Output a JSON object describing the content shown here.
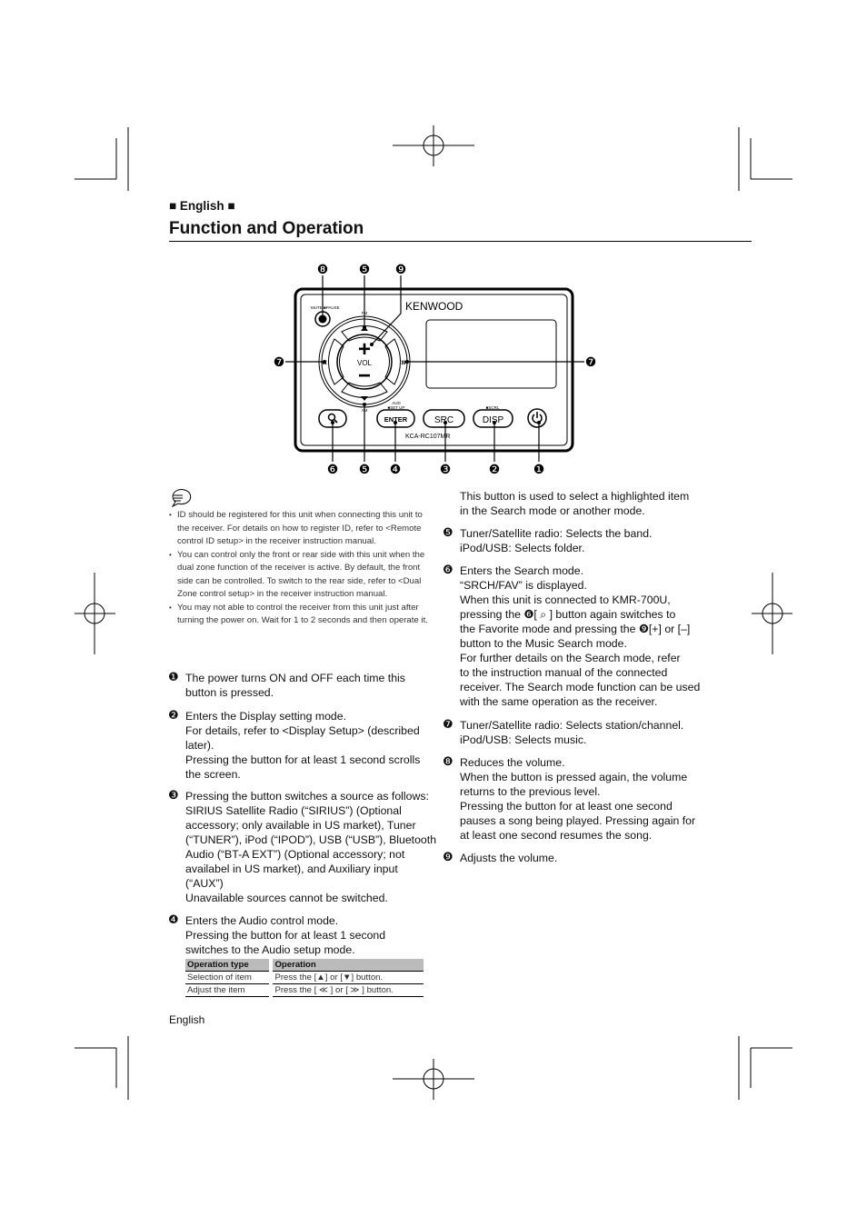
{
  "header": {
    "language": "■ English ■",
    "title": "Function and Operation"
  },
  "device": {
    "brand": "KENWOOD",
    "model": "KCA-RC107MR",
    "mute_label": "MUTE ■PAUSE",
    "fm_label": "FM",
    "am_label": "AM",
    "vol_label": "VOL",
    "plus": "+",
    "minus": "−",
    "aud_label": "AUD",
    "setup_label": "■SET UP",
    "scrl_label": "■SCRL",
    "enter": "ENTER",
    "src": "SRC",
    "disp": "DISP",
    "callouts": {
      "c8": "❽",
      "c5a": "❺",
      "c9": "❾",
      "c7l": "❼",
      "c7r": "❼",
      "c6": "❻",
      "c5b": "❺",
      "c4": "❹",
      "c3": "❸",
      "c2": "❷",
      "c1": "❶"
    }
  },
  "notes": {
    "icon": "note-icon",
    "items": [
      "ID should be registered for this unit when connecting this unit to the receiver. For details on how to register ID, refer to <Remote control ID setup> in the receiver instruction manual.",
      "You can control only the front or rear side with this unit when the dual zone function of the receiver is active. By default, the front side can be controlled. To switch to the rear side, refer to <Dual Zone control setup> in the receiver instruction manual.",
      "You may not able to control the receiver from this unit just after turning the power on. Wait for 1 to 2 seconds and then operate it."
    ]
  },
  "items": {
    "i1": {
      "num": "❶",
      "lines": [
        "The power turns ON and OFF each time this",
        "button is pressed."
      ]
    },
    "i2": {
      "num": "❷",
      "lines": [
        "Enters the Display setting mode.",
        "For details, refer to <Display Setup> (described",
        "later).",
        "Pressing the button for at least 1 second scrolls",
        "the screen."
      ]
    },
    "i3": {
      "num": "❸",
      "lines": [
        "Pressing the button switches a source as follows:",
        "SIRIUS Satellite Radio (“SIRIUS”) (Optional",
        "accessory; only available in US market), Tuner",
        "(“TUNER”), iPod (“IPOD”), USB (“USB”), Bluetooth",
        "Audio (“BT-A EXT”) (Optional accessory; not",
        "availabel in US market), and Auxiliary input",
        "(“AUX”)",
        "Unavailable sources cannot be switched."
      ]
    },
    "i4": {
      "num": "❹",
      "lines": [
        "Enters the Audio control mode.",
        "Pressing the button for at least 1 second",
        "switches to the Audio setup mode."
      ]
    },
    "i4b": {
      "num": "",
      "lines": [
        "This button is used to select a highlighted item",
        "in the Search mode or another mode."
      ]
    },
    "i5": {
      "num": "❺",
      "lines": [
        "Tuner/Satellite radio: Selects the band.",
        "iPod/USB: Selects folder."
      ]
    },
    "i6": {
      "num": "❻",
      "lines": [
        "Enters the Search mode.",
        "“SRCH/FAV” is displayed.",
        "When this unit is connected to KMR-700U,",
        "pressing the ❻[ ⌕ ] button again switches to",
        "the Favorite mode and pressing the ❾[+] or [–]",
        "button to the Music Search mode.",
        "For further details on the Search mode, refer",
        "to the instruction manual of the connected",
        "receiver. The Search mode function can be used",
        "with the same operation as the receiver."
      ]
    },
    "i7": {
      "num": "❼",
      "lines": [
        "Tuner/Satellite radio: Selects station/channel.",
        "iPod/USB: Selects music."
      ]
    },
    "i8": {
      "num": "❽",
      "lines": [
        "Reduces the volume.",
        "When the button is pressed again, the volume",
        "returns to the previous level.",
        "Pressing the button for at least one second",
        "pauses a song being played. Pressing again for",
        "at least one second resumes the song."
      ]
    },
    "i9": {
      "num": "❾",
      "lines": [
        "Adjusts the volume."
      ]
    }
  },
  "table": {
    "headers": [
      "Operation type",
      "Operation"
    ],
    "rows": [
      [
        "Selection of item",
        "Press the [▲] or [▼] button."
      ],
      [
        "Adjust the item",
        "Press the [ ≪ ] or [ ≫ ] button."
      ]
    ]
  },
  "footer": {
    "text": "English"
  }
}
